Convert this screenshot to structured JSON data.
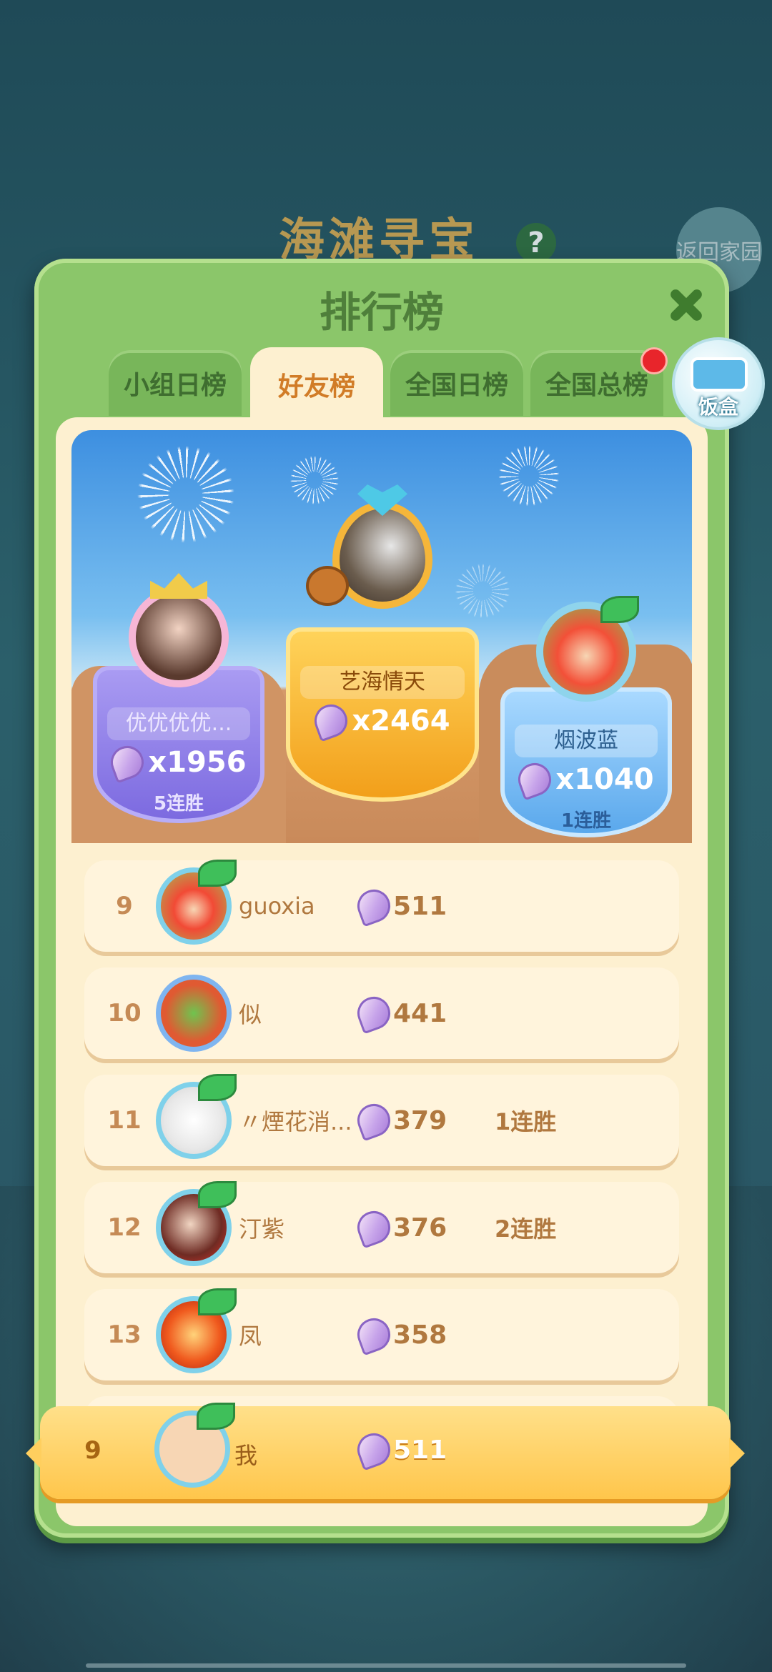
{
  "background": {
    "title": "海滩寻宝",
    "help": "?",
    "back": "返回家园"
  },
  "panel": {
    "title": "排行榜"
  },
  "tabs": [
    {
      "label": "小组日榜",
      "active": false
    },
    {
      "label": "好友榜",
      "active": true
    },
    {
      "label": "全国日榜",
      "active": false
    },
    {
      "label": "全国总榜",
      "active": false
    }
  ],
  "lunchbox": {
    "label": "饭盒"
  },
  "podium": {
    "first": {
      "name": "艺海情天",
      "score": "x2464",
      "streak": ""
    },
    "second": {
      "name": "优优优优...",
      "score": "x1956",
      "streak": "5连胜"
    },
    "third": {
      "name": "烟波蓝",
      "score": "x1040",
      "streak": "1连胜"
    }
  },
  "rows": [
    {
      "rank": "9",
      "name": "guoxia",
      "score": "511",
      "streak": ""
    },
    {
      "rank": "10",
      "name": "似",
      "score": "441",
      "streak": ""
    },
    {
      "rank": "11",
      "name": "〃煙花消...",
      "score": "379",
      "streak": "1连胜"
    },
    {
      "rank": "12",
      "name": "汀紫",
      "score": "376",
      "streak": "2连胜"
    },
    {
      "rank": "13",
      "name": "凤",
      "score": "358",
      "streak": ""
    }
  ],
  "self": {
    "rank": "9",
    "name": "我",
    "score": "511"
  },
  "colors": {
    "panel": "#8bc66a",
    "content": "#fdf0d0",
    "self_bar": "#ffc64b"
  }
}
